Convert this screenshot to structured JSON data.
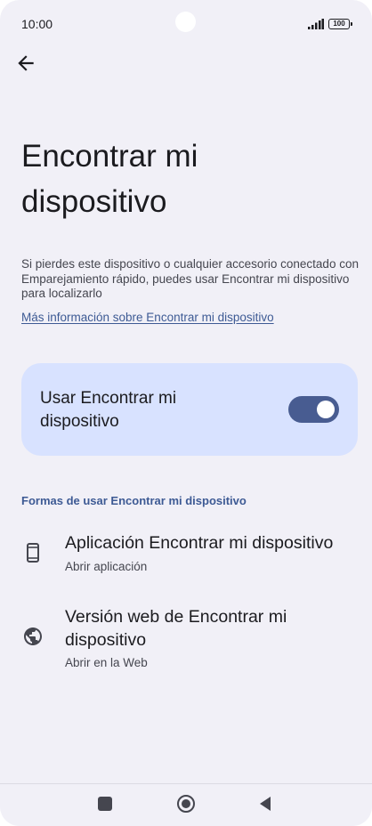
{
  "status_bar": {
    "time": "10:00",
    "battery": "100"
  },
  "header": {
    "back_icon": "arrow-back-icon"
  },
  "page": {
    "title": "Encontrar mi dispositivo",
    "description": "Si pierdes este dispositivo o cualquier accesorio conectado con Emparejamiento rápido, puedes usar Encontrar mi dispositivo para localizarlo",
    "more_link": "Más información sobre Encontrar mi dispositivo"
  },
  "toggle": {
    "label": "Usar Encontrar mi dispositivo",
    "enabled": true,
    "accent_color": "#485c91"
  },
  "section": {
    "header": "Formas de usar Encontrar mi dispositivo",
    "items": [
      {
        "icon": "phone-icon",
        "title": "Aplicación Encontrar mi dispositivo",
        "subtitle": "Abrir aplicación"
      },
      {
        "icon": "globe-icon",
        "title": "Versión web de Encontrar mi dispositivo",
        "subtitle": "Abrir en la Web"
      }
    ]
  },
  "nav_bar": {
    "buttons": [
      "recents-square-icon",
      "home-circle-icon",
      "back-triangle-icon"
    ]
  }
}
